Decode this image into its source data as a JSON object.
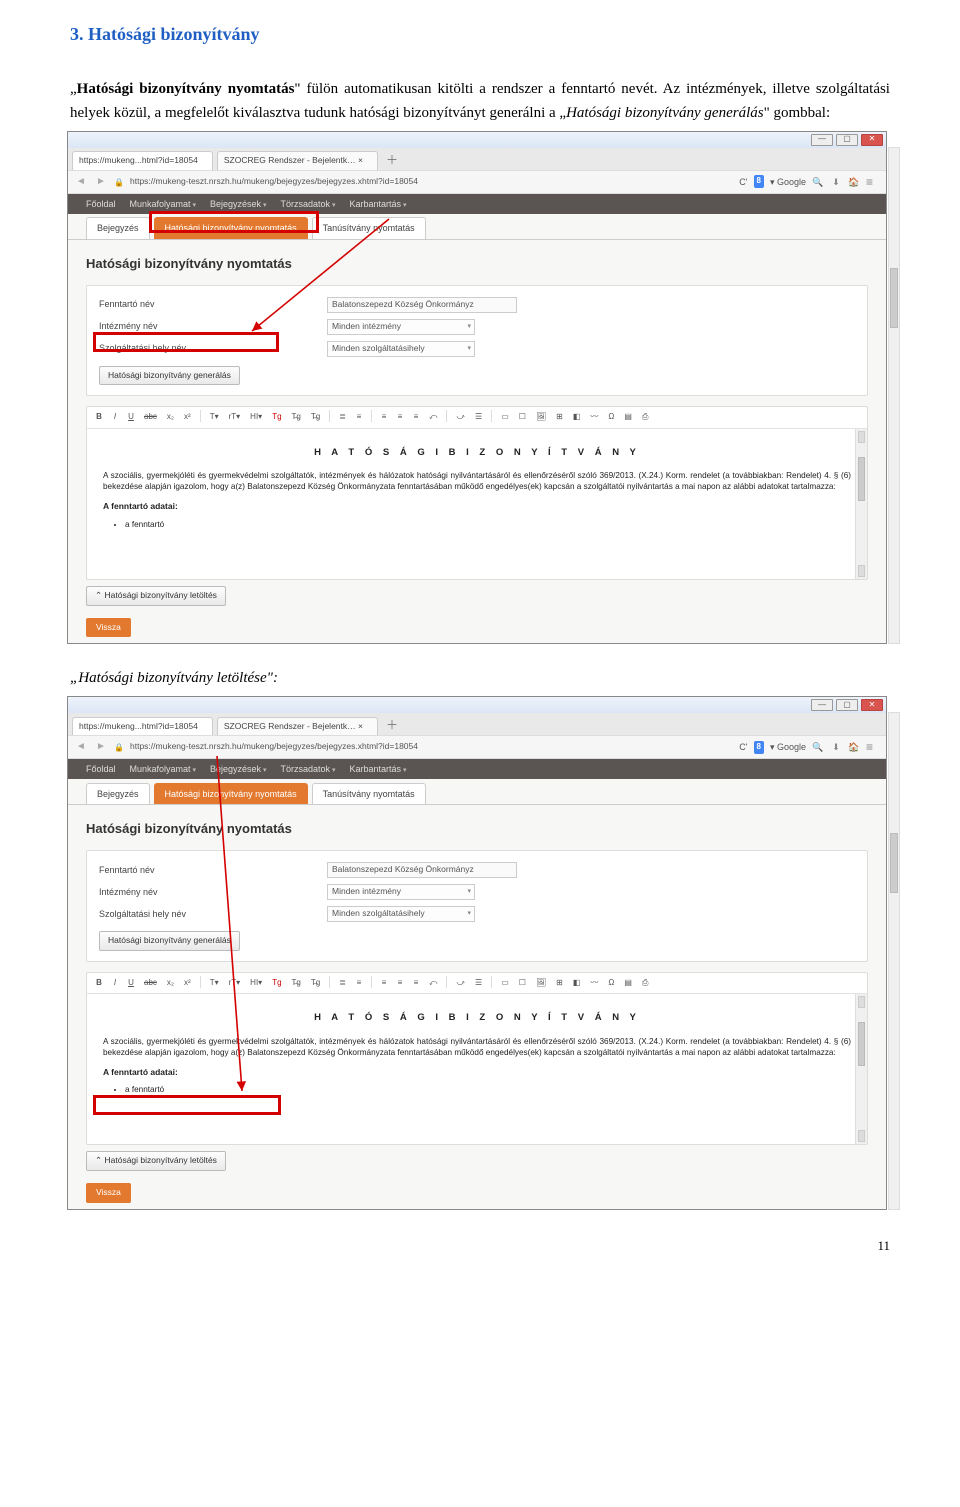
{
  "heading": "3.  Hatósági bizonyítvány",
  "para1_a": "„",
  "para1_b": "Hatósági bizonyítvány nyomtatás",
  "para1_c": "\" fülön automatikusan kitölti a rendszer a fenntartó nevét. Az intézmények, illetve szolgáltatási helyek közül, a megfelelőt kiválasztva tudunk hatósági bizonyítványt generálni a „",
  "para1_d": "Hatósági bizonyítvány generálás",
  "para1_e": "\" gombbal:",
  "caption2_a": "„",
  "caption2_b": "Hatósági bizonyítvány letöltése",
  "caption2_c": "\":",
  "page_number": "11",
  "shot": {
    "tab1": "https://mukeng...html?id=18054",
    "tab2": "SZOCREG Rendszer - Bejelentk…  ×",
    "plus": "＋",
    "url": "https://mukeng-teszt.nrszh.hu/mukeng/bejegyzes/bejegyzes.xhtml?id=18054",
    "search_reload": "C'",
    "google_g": "8",
    "google_label": "▾ Google",
    "nav": {
      "fooldal": "Főoldal",
      "munkafolyamat": "Munkafolyamat",
      "bejegyzesek": "Bejegyzések",
      "torzsadatok": "Törzsadatok",
      "karbantartas": "Karbantartás"
    },
    "subtabs": {
      "bejegyzes": "Bejegyzés",
      "hatosagi": "Hatósági bizonyítvány nyomtatás",
      "tanusitvany": "Tanúsítvány nyomtatás"
    },
    "panel_title": "Hatósági bizonyítvány nyomtatás",
    "form": {
      "fenntarto_label": "Fenntartó név",
      "fenntarto_value": "Balatonszepezd Község Önkormányz",
      "intezmeny_label": "Intézmény név",
      "intezmeny_value": "Minden intézmény",
      "szolg_label": "Szolgáltatási hely név",
      "szolg_value": "Minden szolgáltatásihely",
      "gen_button": "Hatósági bizonyítvány generálás"
    },
    "doc": {
      "title": "H A T Ó S Á G I  B I Z O N Y Í T V Á N Y",
      "body": "A szociális, gyermekjóléti és gyermekvédelmi szolgáltatók, intézmények és hálózatok hatósági nyilvántartásáról és ellenőrzéséről szóló 369/2013. (X.24.) Korm. rendelet (a továbbiakban: Rendelet) 4. § (6) bekezdése alapján igazolom, hogy a(z) Balatonszepezd Község Önkormányzata fenntartásában működő engedélyes(ek) kapcsán a szolgáltatói nyilvántartás a mai napon az alábbi adatokat tartalmazza:",
      "sub": "A fenntartó adatai:",
      "bullet": "a fenntartó"
    },
    "acc_button": "Hatósági bizonyítvány letöltés",
    "vissza": "Vissza",
    "toolbar": [
      "B",
      "I",
      "U",
      "abc",
      "x₂",
      "x²",
      "T▾",
      "rT▾",
      "HI▾",
      "Tg",
      "T̶g",
      "T̶g",
      "≣",
      "≡",
      "≡",
      "≡",
      "≡",
      "⤺",
      "⤻",
      "☰",
      "▭",
      "☐",
      "🖼",
      "⊞",
      "◧",
      "〰",
      "Ω",
      "▤",
      "⎙"
    ]
  }
}
